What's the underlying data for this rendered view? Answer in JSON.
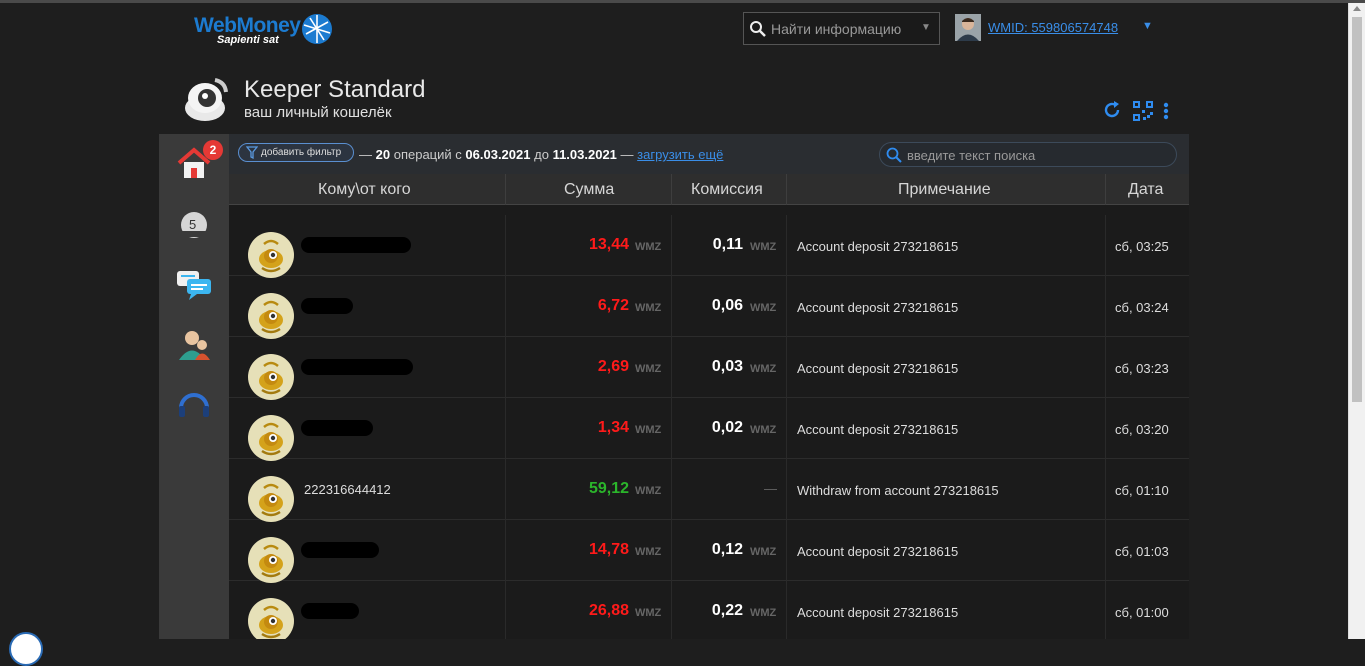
{
  "header": {
    "logo_name": "WebMoney",
    "logo_slogan": "Sapienti sat",
    "search_placeholder": "Найти информацию",
    "wmid": "WMID: 559806574748"
  },
  "app": {
    "title": "Keeper Standard",
    "subtitle": "ваш личный кошелёк"
  },
  "sidebar": {
    "home_badge": "2",
    "second_badge": "5"
  },
  "toolbar": {
    "filter_label": "добавить фильтр",
    "ops_prefix": "—",
    "ops_count": "20",
    "ops_word": "операций",
    "from_word": "с",
    "date_from": "06.03.2021",
    "to_word": "до",
    "date_to": "11.03.2021",
    "dash2": "—",
    "load_more": "загрузить ещё",
    "search_placeholder": "введите текст поиска"
  },
  "columns": {
    "who": "Кому\\от кого",
    "amount": "Сумма",
    "fee": "Комиссия",
    "note": "Примечание",
    "date": "Дата"
  },
  "rows": [
    {
      "who": "",
      "amount": "13,44",
      "currency": "WMZ",
      "fee": "0,11",
      "fee_currency": "WMZ",
      "note": "Account deposit 273218615",
      "date": "сб, 03:25",
      "type": "out"
    },
    {
      "who": "",
      "amount": "6,72",
      "currency": "WMZ",
      "fee": "0,06",
      "fee_currency": "WMZ",
      "note": "Account deposit 273218615",
      "date": "сб, 03:24",
      "type": "out"
    },
    {
      "who": "",
      "amount": "2,69",
      "currency": "WMZ",
      "fee": "0,03",
      "fee_currency": "WMZ",
      "note": "Account deposit 273218615",
      "date": "сб, 03:23",
      "type": "out"
    },
    {
      "who": "",
      "amount": "1,34",
      "currency": "WMZ",
      "fee": "0,02",
      "fee_currency": "WMZ",
      "note": "Account deposit 273218615",
      "date": "сб, 03:20",
      "type": "out"
    },
    {
      "who": "222316644412",
      "amount": "59,12",
      "currency": "WMZ",
      "fee": "",
      "fee_dash": "—",
      "note": "Withdraw from account 273218615",
      "date": "сб, 01:10",
      "type": "in"
    },
    {
      "who": "",
      "amount": "14,78",
      "currency": "WMZ",
      "fee": "0,12",
      "fee_currency": "WMZ",
      "note": "Account deposit 273218615",
      "date": "сб, 01:03",
      "type": "out"
    },
    {
      "who": "",
      "amount": "26,88",
      "currency": "WMZ",
      "fee": "0,22",
      "fee_currency": "WMZ",
      "note": "Account deposit 273218615",
      "date": "сб, 01:00",
      "type": "out"
    }
  ],
  "colors": {
    "accent": "#3a8ee8",
    "negative": "#ff1a1a",
    "positive": "#2bb52b",
    "badge": "#e53935"
  }
}
